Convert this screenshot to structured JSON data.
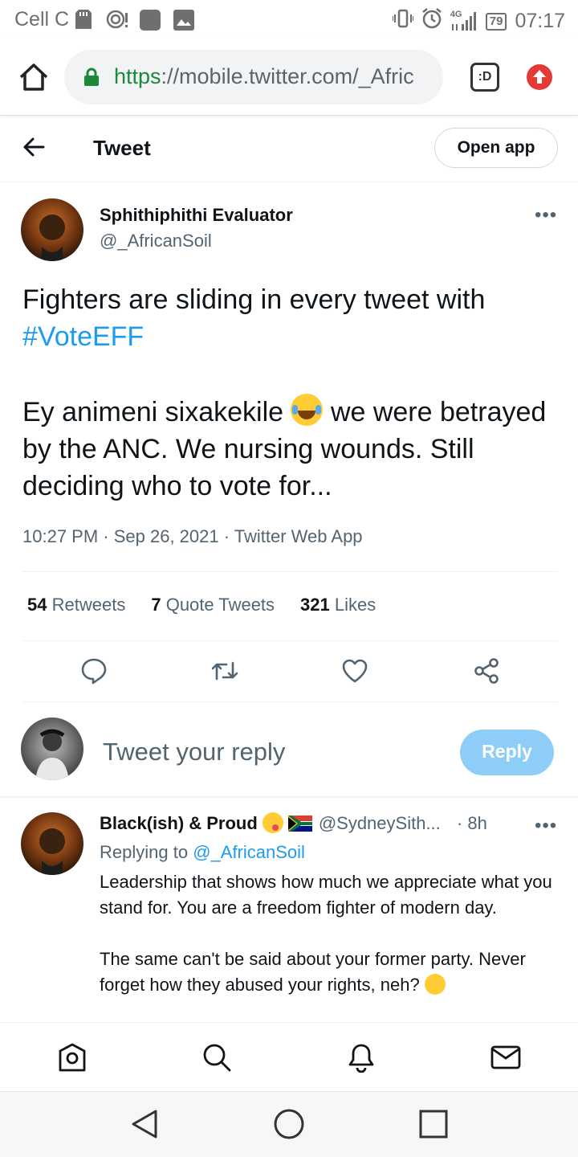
{
  "status_bar": {
    "carrier": "Cell C",
    "network": "4G",
    "battery": "79",
    "time": "07:17"
  },
  "browser": {
    "url_scheme": "https",
    "url_rest": "://mobile.twitter.com/_Afric",
    "tabs_label": ":D"
  },
  "header": {
    "title": "Tweet",
    "open_app_label": "Open app"
  },
  "tweet": {
    "author_name": "Sphithiphithi Evaluator",
    "author_handle": "@_AfricanSoil",
    "text_line1": "Fighters are sliding in every tweet with",
    "hashtag": "#VoteEFF",
    "text_line2_a": "Ey animeni sixakekile",
    "text_line2_b": "we were betrayed by the ANC. We nursing wounds. Still deciding who to vote for...",
    "timestamp": "10:27 PM · Sep 26, 2021 · Twitter Web App",
    "stats": {
      "retweets_count": "54",
      "retweets_label": "Retweets",
      "quotes_count": "7",
      "quotes_label": "Quote Tweets",
      "likes_count": "321",
      "likes_label": "Likes"
    },
    "actions": [
      "reply-icon",
      "retweet-icon",
      "like-icon",
      "share-icon"
    ]
  },
  "composer": {
    "placeholder": "Tweet your reply",
    "reply_label": "Reply"
  },
  "reply": {
    "name": "Black(ish) & Proud",
    "handle": "@SydneySith...",
    "time": "· 8h",
    "replying_prefix": "Replying to",
    "replying_to": "@_AfricanSoil",
    "para1": "Leadership that shows how much we appreciate what you stand for. You are a freedom fighter of modern day.",
    "para2": "The same can't be said about your former party. Never forget how they abused your rights, neh?"
  },
  "bottom_nav": [
    "home-icon",
    "search-icon",
    "notifications-icon",
    "messages-icon"
  ],
  "system_nav": [
    "back-icon",
    "home-circle-icon",
    "recents-icon"
  ],
  "colors": {
    "accent": "#1d9bf0",
    "reply_button": "#8ecdf8",
    "text": "#0f1419",
    "secondary": "#536471",
    "secure": "#1a8a3a"
  }
}
